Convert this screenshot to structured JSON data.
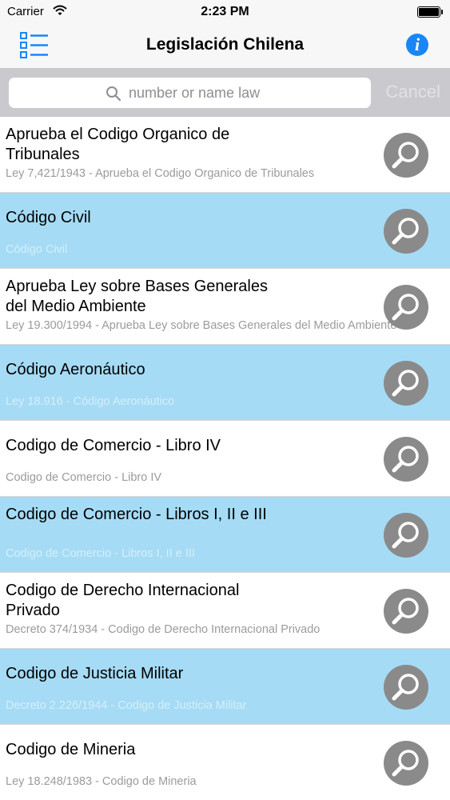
{
  "status_bar": {
    "carrier": "Carrier",
    "time": "2:23 PM"
  },
  "nav": {
    "title": "Legislación Chilena",
    "left_icon": "list-icon",
    "right_icon": "info-icon",
    "info_glyph": "i",
    "accent_color": "#1a86f5"
  },
  "search": {
    "placeholder": "number or name law",
    "value": "",
    "cancel_label": "Cancel"
  },
  "colors": {
    "row_highlight": "#a5dbf5",
    "row_button": "#8a8a8a"
  },
  "laws": [
    {
      "title": "Aprueba el Codigo Organico de Tribunales",
      "subtitle": "Ley 7,421/1943 - Aprueba el Codigo Organico de Tribunales",
      "highlighted": false
    },
    {
      "title": "Código Civil",
      "subtitle": "Código Civil",
      "highlighted": true
    },
    {
      "title": "Aprueba Ley sobre Bases Generales del Medio Ambiente",
      "subtitle": "Ley 19.300/1994 - Aprueba Ley sobre Bases Generales del Medio Ambiente",
      "highlighted": false
    },
    {
      "title": "Código Aeronáutico",
      "subtitle": "Ley 18.916 - Código Aeronáutico",
      "highlighted": true
    },
    {
      "title": "Codigo de Comercio - Libro IV",
      "subtitle": "Codigo de Comercio - Libro IV",
      "highlighted": false
    },
    {
      "title": "Codigo de Comercio - Libros I, II e III",
      "subtitle": "Codigo de Comercio - Libros I, II e III",
      "highlighted": true
    },
    {
      "title": "Codigo de Derecho Internacional Privado",
      "subtitle": "Decreto 374/1934 - Codigo de Derecho Internacional Privado",
      "highlighted": false
    },
    {
      "title": "Codigo de Justicia Militar",
      "subtitle": "Decreto 2.226/1944 - Codigo de Justicia Militar",
      "highlighted": true
    },
    {
      "title": "Codigo de Mineria",
      "subtitle": "Ley 18.248/1983 - Codigo de Mineria",
      "highlighted": false
    }
  ]
}
